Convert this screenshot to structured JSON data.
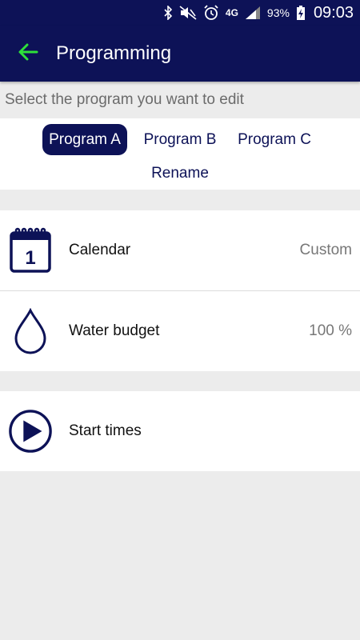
{
  "status_bar": {
    "network": "4G",
    "battery": "93%",
    "time": "09:03"
  },
  "app_bar": {
    "title": "Programming"
  },
  "subtitle": "Select the program you want to edit",
  "programs": {
    "tabs": [
      "Program A",
      "Program B",
      "Program C"
    ],
    "selected": "Program A",
    "rename_label": "Rename"
  },
  "settings": {
    "calendar": {
      "label": "Calendar",
      "value": "Custom"
    },
    "water_budget": {
      "label": "Water budget",
      "value": "100 %"
    },
    "start_times": {
      "label": "Start times"
    }
  },
  "colors": {
    "primary": "#0d1257",
    "back_arrow": "#2ee03a",
    "background": "#ececec"
  },
  "icons": [
    "bluetooth-icon",
    "mute-icon",
    "alarm-icon",
    "signal-icon",
    "battery-icon",
    "back-arrow-icon",
    "calendar-icon",
    "water-drop-icon",
    "play-icon"
  ]
}
